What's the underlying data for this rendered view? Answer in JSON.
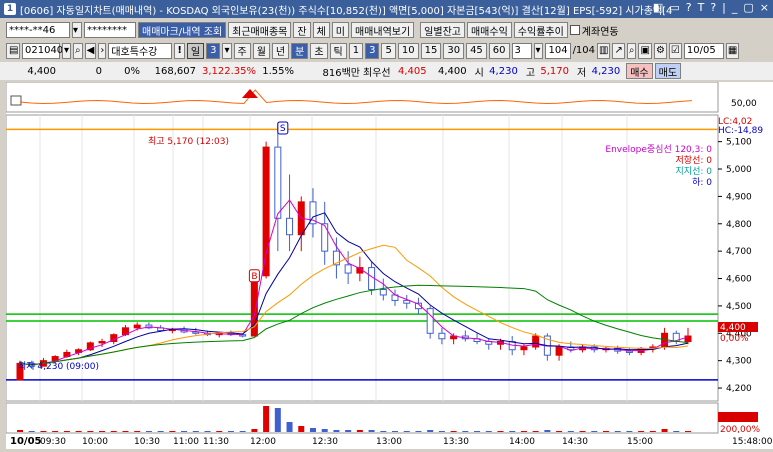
{
  "window": {
    "title": "[0606] 자동일지차트(매매내역) - KOSDAQ 외국인보유(23(천)) 주식수[10,852(천)] 액면[5,000] 자본금[543(억)] 결산[12월] EPS[-592] 시가총액[4",
    "icon_label": "1",
    "controls": [
      "◧",
      "▭",
      "?",
      "T",
      "?",
      "|",
      "_",
      "▢",
      "×"
    ]
  },
  "toolbar1": {
    "account": "****-**46",
    "password": "********",
    "buttons": [
      "매매마크/내역 조회",
      "최근매매종목",
      "잔",
      "체",
      "미",
      "매매내역보기",
      "일별잔고",
      "매매수익",
      "수익률추이"
    ],
    "checkbox_label": "계좌연동"
  },
  "toolbar2": {
    "code": "021040",
    "name": "대호특수강",
    "periods": [
      "일",
      "3",
      "주",
      "월",
      "년",
      "분",
      "초",
      "틱",
      "1",
      "3",
      "5",
      "10",
      "15",
      "30",
      "45",
      "60"
    ],
    "interval": "3",
    "count": "104",
    "total": "/104",
    "date": "10/05"
  },
  "quote": {
    "price": "4,400",
    "change": "0",
    "pct": "0%",
    "volume": "168,607",
    "vol_ratio": "3,122.35%",
    "turnover": "1.55%",
    "amount": "816백만",
    "best_ask_label": "최우선",
    "best_ask": "4,405",
    "best_bid": "4,400",
    "open_label": "시",
    "open": "4,230",
    "high_label": "고",
    "high": "5,170",
    "low_label": "저",
    "low": "4,230",
    "buy_label": "매수",
    "sell_label": "매도"
  },
  "chart_data": {
    "type": "candlestick",
    "date": "10/05",
    "x_ticks": [
      "09:30",
      "10:00",
      "10:30",
      "11:00",
      "11:30",
      "12:00",
      "12:30",
      "13:00",
      "13:30",
      "14:00",
      "14:30",
      "15:00",
      "15:48:00"
    ],
    "y_ticks": [
      "5,100",
      "5,000",
      "4,900",
      "4,800",
      "4,700",
      "4,600",
      "4,500",
      "4,400",
      "4,300",
      "4,200"
    ],
    "ylim": [
      4160,
      5190
    ],
    "indicator_tick": "50,00",
    "high_annotation": "최고 5,170 (12:03)",
    "low_annotation": "최저 4,230 (09:00)",
    "right_labels": {
      "lc": "LC:4,02",
      "hc": "HC:-14,89",
      "price_tag": "4,400",
      "pct_tag": "0,00%",
      "vol_tag": "200,00%"
    },
    "legend": [
      {
        "name": "Envelope중심선 120,3: 0",
        "color": "#cc00cc"
      },
      {
        "name": "저항선: 0",
        "color": "#d80000"
      },
      {
        "name": "지지선: 0",
        "color": "#00a0a0"
      },
      {
        "name": "하: 0",
        "color": "#0000d0"
      }
    ],
    "horizontal_lines": [
      {
        "y": 4470,
        "color": "#00c000"
      },
      {
        "y": 4445,
        "color": "#00c000"
      },
      {
        "y": 4230,
        "color": "#0000d0"
      },
      {
        "y": 5145,
        "color": "#ff9900"
      }
    ],
    "markers": [
      {
        "label": "S",
        "x": "12:03",
        "y": 5150
      },
      {
        "label": "B",
        "x": "12:00",
        "y": 4610
      }
    ],
    "colors": {
      "up": "#e00000",
      "down": "#4060d0",
      "ma1": "#d000d0",
      "ma2": "#0000a0",
      "ma3": "#ff9900",
      "ma4": "#008000"
    }
  }
}
